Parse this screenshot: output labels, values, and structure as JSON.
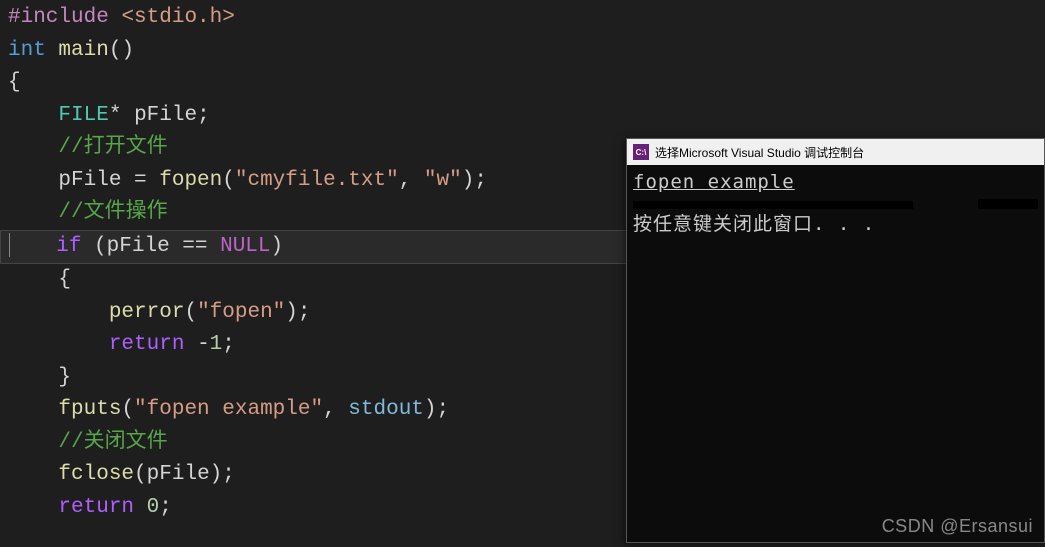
{
  "code": {
    "l1_include": "#include",
    "l1_sp": " ",
    "l1_header": "<stdio.h>",
    "l2_int": "int",
    "l2_sp": " ",
    "l2_main": "main",
    "l2_parens": "()",
    "l3": "{",
    "l4_indent": "    ",
    "l4_type": "FILE",
    "l4_star": "* ",
    "l4_var": "pFile",
    "l4_semi": ";",
    "l5_indent": "    ",
    "l5_comment": "//打开文件",
    "l6_indent": "    ",
    "l6_lhs": "pFile = ",
    "l6_func": "fopen",
    "l6_p1": "(",
    "l6_s1": "\"cmyfile.txt\"",
    "l6_comma": ", ",
    "l6_s2": "\"w\"",
    "l6_p2": ");",
    "l7_indent": "    ",
    "l7_comment": "//文件操作",
    "l8_indent": "    ",
    "l8_if": "if",
    "l8_sp": " ",
    "l8_p1": "(",
    "l8_var": "pFile",
    "l8_eq": " == ",
    "l8_null": "NULL",
    "l8_p2": ")",
    "l9_indent": "    ",
    "l9_brace": "{",
    "l10_indent": "        ",
    "l10_func": "perror",
    "l10_p1": "(",
    "l10_s": "\"fopen\"",
    "l10_p2": ");",
    "l11_indent": "        ",
    "l11_ret": "return",
    "l11_sp": " ",
    "l11_neg": "-",
    "l11_num": "1",
    "l11_semi": ";",
    "l12_indent": "    ",
    "l12_brace": "}",
    "l13_indent": "    ",
    "l13_func": "fputs",
    "l13_p1": "(",
    "l13_s": "\"fopen example\"",
    "l13_comma": ", ",
    "l13_arg": "stdout",
    "l13_p2": ");",
    "l14_indent": "    ",
    "l14_comment": "//关闭文件",
    "l15_indent": "    ",
    "l15_func": "fclose",
    "l15_p1": "(",
    "l15_arg": "pFile",
    "l15_p2": ");",
    "l16_indent": "    ",
    "l16_ret": "return",
    "l16_sp": " ",
    "l16_num": "0",
    "l16_semi": ";"
  },
  "console": {
    "title": "选择Microsoft Visual Studio 调试控制台",
    "icon_text": "C:\\",
    "line1": "fopen example",
    "line2": "按任意键关闭此窗口. . ."
  },
  "watermark": "CSDN @Ersansui"
}
